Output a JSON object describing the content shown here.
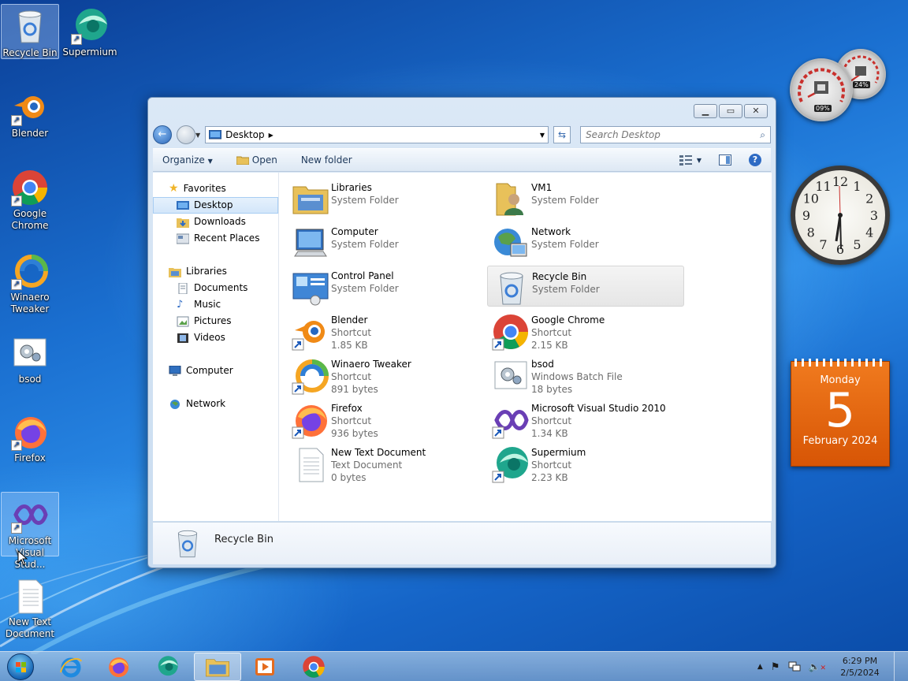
{
  "desktop_icons": [
    {
      "label": "Recycle Bin",
      "icon": "recycle-bin-icon"
    },
    {
      "label": "Supermium",
      "icon": "supermium-icon"
    },
    {
      "label": "Blender",
      "icon": "blender-icon"
    },
    {
      "label": "Google Chrome",
      "icon": "chrome-icon"
    },
    {
      "label": "Winaero Tweaker",
      "icon": "winaero-icon"
    },
    {
      "label": "bsod",
      "icon": "batch-file-icon"
    },
    {
      "label": "Firefox",
      "icon": "firefox-icon"
    },
    {
      "label": "Microsoft Visual Stud...",
      "icon": "visual-studio-icon"
    },
    {
      "label": "New Text Document",
      "icon": "text-document-icon"
    }
  ],
  "explorer": {
    "address": "Desktop",
    "search_placeholder": "Search Desktop",
    "toolbar": {
      "organize": "Organize",
      "open": "Open",
      "new_folder": "New folder"
    },
    "nav": {
      "favorites": "Favorites",
      "desktop": "Desktop",
      "downloads": "Downloads",
      "recent_places": "Recent Places",
      "libraries": "Libraries",
      "documents": "Documents",
      "music": "Music",
      "pictures": "Pictures",
      "videos": "Videos",
      "computer": "Computer",
      "network": "Network"
    },
    "items": [
      {
        "name": "Libraries",
        "type": "System Folder",
        "size": ""
      },
      {
        "name": "VM1",
        "type": "System Folder",
        "size": ""
      },
      {
        "name": "Computer",
        "type": "System Folder",
        "size": ""
      },
      {
        "name": "Network",
        "type": "System Folder",
        "size": ""
      },
      {
        "name": "Control Panel",
        "type": "System Folder",
        "size": ""
      },
      {
        "name": "Recycle Bin",
        "type": "System Folder",
        "size": ""
      },
      {
        "name": "Blender",
        "type": "Shortcut",
        "size": "1.85 KB"
      },
      {
        "name": "Google Chrome",
        "type": "Shortcut",
        "size": "2.15 KB"
      },
      {
        "name": "Winaero Tweaker",
        "type": "Shortcut",
        "size": "891 bytes"
      },
      {
        "name": "bsod",
        "type": "Windows Batch File",
        "size": "18 bytes"
      },
      {
        "name": "Firefox",
        "type": "Shortcut",
        "size": "936 bytes"
      },
      {
        "name": "Microsoft Visual Studio 2010",
        "type": "Shortcut",
        "size": "1.34 KB"
      },
      {
        "name": "New Text Document",
        "type": "Text Document",
        "size": "0 bytes"
      },
      {
        "name": "Supermium",
        "type": "Shortcut",
        "size": "2.23 KB"
      }
    ],
    "details_name": "Recycle Bin"
  },
  "gadgets": {
    "cpu_percent": "09%",
    "memory_percent": "24%",
    "clock_numbers": [
      "12",
      "1",
      "2",
      "3",
      "4",
      "5",
      "6",
      "7",
      "8",
      "9",
      "10",
      "11"
    ],
    "calendar": {
      "weekday": "Monday",
      "day": "5",
      "month_year": "February 2024"
    }
  },
  "taskbar": {
    "apps": [
      "Internet Explorer",
      "Firefox",
      "Supermium",
      "Windows Explorer",
      "Media Player",
      "Google Chrome"
    ],
    "time": "6:29 PM",
    "date": "2/5/2024"
  },
  "colors": {
    "accent": "#1a6fd0",
    "calendar": "#e2630f",
    "selection": "#d3e6fa"
  }
}
